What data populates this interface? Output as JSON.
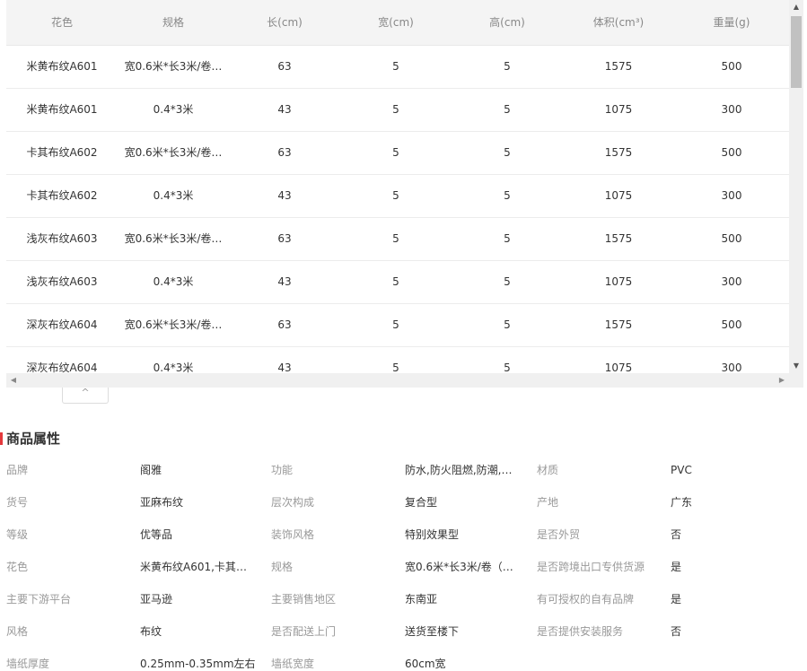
{
  "table": {
    "headers": [
      "花色",
      "规格",
      "长(cm)",
      "宽(cm)",
      "高(cm)",
      "体积(cm³)",
      "重量(g)"
    ],
    "rows": [
      [
        "米黄布纹A601",
        "宽0.6米*长3米/卷…",
        "63",
        "5",
        "5",
        "1575",
        "500"
      ],
      [
        "米黄布纹A601",
        "0.4*3米",
        "43",
        "5",
        "5",
        "1075",
        "300"
      ],
      [
        "卡其布纹A602",
        "宽0.6米*长3米/卷…",
        "63",
        "5",
        "5",
        "1575",
        "500"
      ],
      [
        "卡其布纹A602",
        "0.4*3米",
        "43",
        "5",
        "5",
        "1075",
        "300"
      ],
      [
        "浅灰布纹A603",
        "宽0.6米*长3米/卷…",
        "63",
        "5",
        "5",
        "1575",
        "500"
      ],
      [
        "浅灰布纹A603",
        "0.4*3米",
        "43",
        "5",
        "5",
        "1075",
        "300"
      ],
      [
        "深灰布纹A604",
        "宽0.6米*长3米/卷…",
        "63",
        "5",
        "5",
        "1575",
        "500"
      ],
      [
        "深灰布纹A604",
        "0.4*3米",
        "43",
        "5",
        "5",
        "1075",
        "300"
      ]
    ]
  },
  "icons": {
    "scroll_up": "▲",
    "scroll_down": "▼",
    "scroll_left": "◀",
    "scroll_right": "▶",
    "collapse": "^"
  },
  "attributes": {
    "title": "商品属性",
    "rows": [
      [
        {
          "k": "品牌",
          "v": "阁雅"
        },
        {
          "k": "功能",
          "v": "防水,防火阻燃,防潮,…"
        },
        {
          "k": "材质",
          "v": "PVC"
        }
      ],
      [
        {
          "k": "货号",
          "v": "亚麻布纹"
        },
        {
          "k": "层次构成",
          "v": "复合型"
        },
        {
          "k": "产地",
          "v": "广东"
        }
      ],
      [
        {
          "k": "等级",
          "v": "优等品"
        },
        {
          "k": "装饰风格",
          "v": "特别效果型"
        },
        {
          "k": "是否外贸",
          "v": "否"
        }
      ],
      [
        {
          "k": "花色",
          "v": "米黄布纹A601,卡其布…"
        },
        {
          "k": "规格",
          "v": "宽0.6米*长3米/卷（…"
        },
        {
          "k": "是否跨境出口专供货源",
          "v": "是"
        }
      ],
      [
        {
          "k": "主要下游平台",
          "v": "亚马逊"
        },
        {
          "k": "主要销售地区",
          "v": "东南亚"
        },
        {
          "k": "有可授权的自有品牌",
          "v": "是"
        }
      ],
      [
        {
          "k": "风格",
          "v": "布纹"
        },
        {
          "k": "是否配送上门",
          "v": "送货至楼下"
        },
        {
          "k": "是否提供安装服务",
          "v": "否"
        }
      ],
      [
        {
          "k": "墙纸厚度",
          "v": "0.25mm-0.35mm左右"
        },
        {
          "k": "墙纸宽度",
          "v": "60cm宽"
        }
      ]
    ]
  },
  "colors": {
    "accent_bar": "#e4393c",
    "header_bg": "#f4f4f4",
    "key_text": "#999999",
    "value_text": "#333333"
  }
}
